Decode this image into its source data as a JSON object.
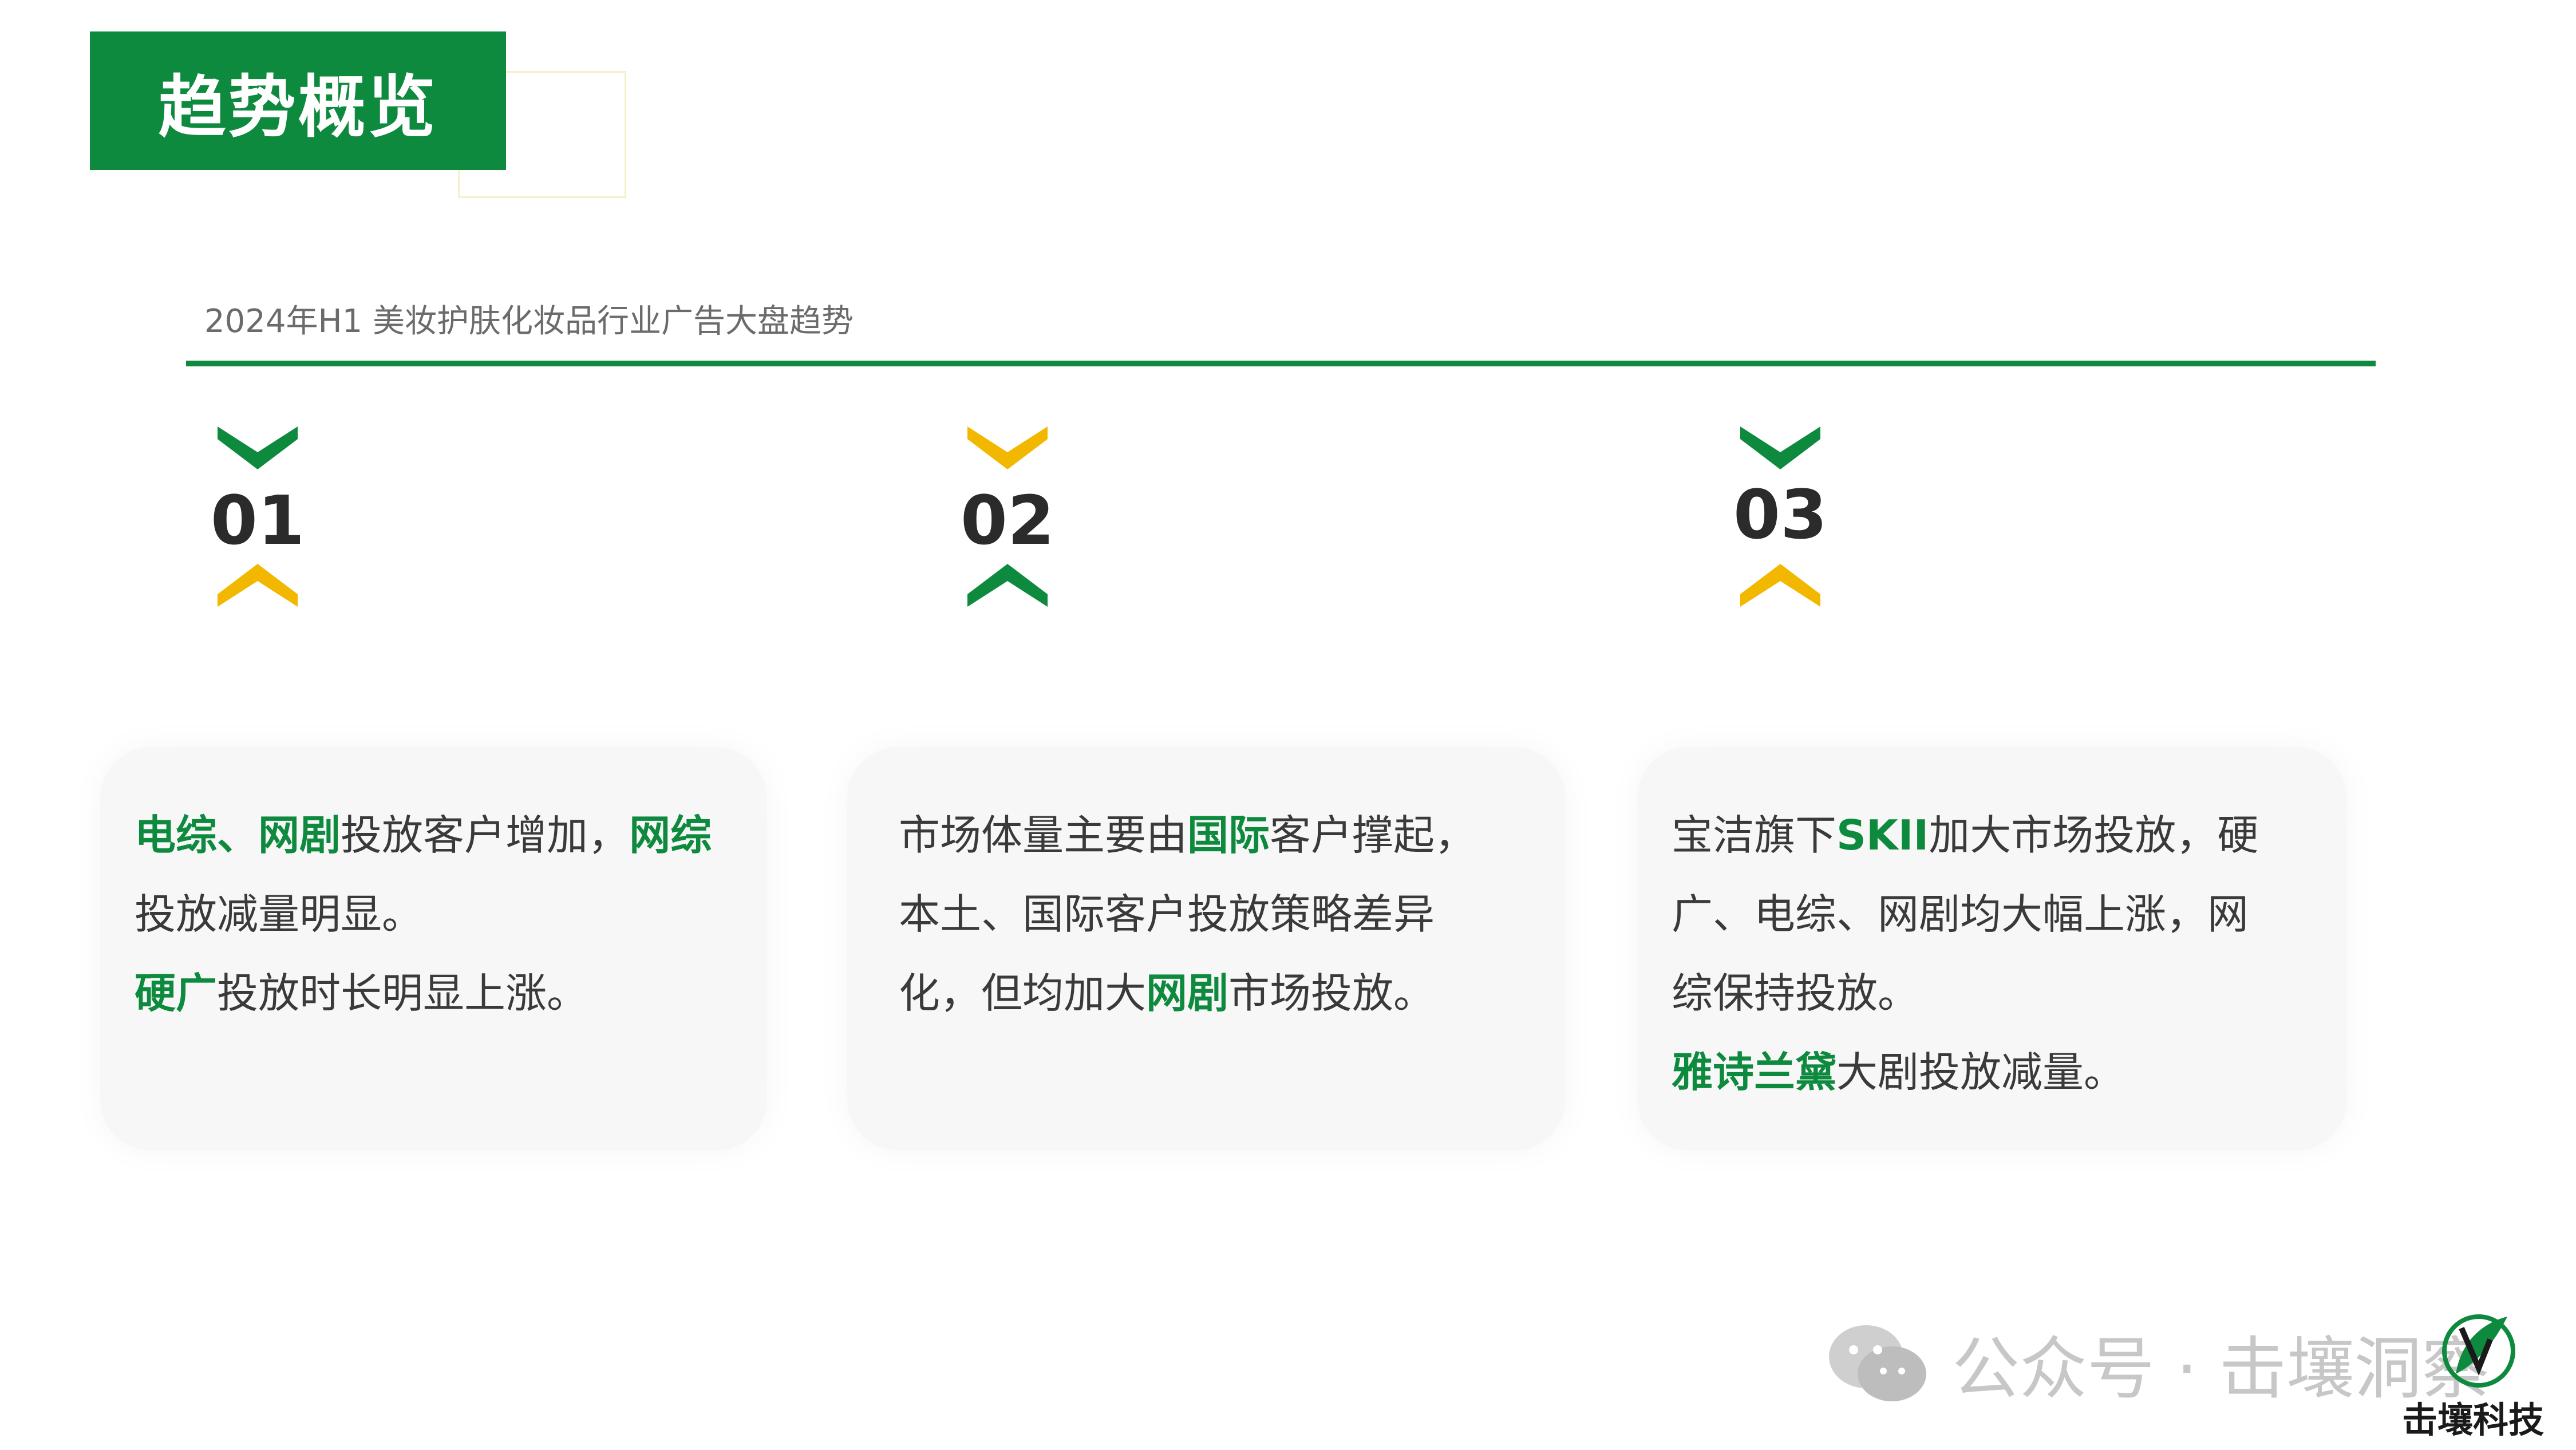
{
  "header": {
    "title": "趋势概览",
    "subtitle": "2024年H1 美妆护肤化妆品行业广告大盘趋势"
  },
  "colors": {
    "brand_green": "#0e8a3e",
    "accent_yellow": "#f2b800",
    "card_bg": "#f7f7f7"
  },
  "steps": [
    {
      "number": "01",
      "top_chevron_color": "green",
      "bottom_chevron_color": "yellow"
    },
    {
      "number": "02",
      "top_chevron_color": "yellow",
      "bottom_chevron_color": "green"
    },
    {
      "number": "03",
      "top_chevron_color": "green",
      "bottom_chevron_color": "yellow"
    }
  ],
  "cards": [
    {
      "lines": [
        [
          {
            "t": "电综",
            "hl": true
          },
          {
            "t": "、",
            "hl": true
          },
          {
            "t": "网剧",
            "hl": true
          },
          {
            "t": "投放客户增加，",
            "hl": false
          },
          {
            "t": "网综",
            "hl": true
          }
        ],
        [
          {
            "t": "投放减量明显。",
            "hl": false
          }
        ],
        [
          {
            "t": "硬广",
            "hl": true
          },
          {
            "t": "投放时长明显上涨。",
            "hl": false
          }
        ]
      ]
    },
    {
      "lines": [
        [
          {
            "t": "市场体量主要由",
            "hl": false
          },
          {
            "t": "国际",
            "hl": true
          },
          {
            "t": "客户撑起，",
            "hl": false
          }
        ],
        [
          {
            "t": "本土、国际客户投放策略差异",
            "hl": false
          }
        ],
        [
          {
            "t": "化，但均加大",
            "hl": false
          },
          {
            "t": "网剧",
            "hl": true
          },
          {
            "t": "市场投放。",
            "hl": false
          }
        ]
      ]
    },
    {
      "lines": [
        [
          {
            "t": "宝洁旗下",
            "hl": false
          },
          {
            "t": "SKII",
            "hl": true
          },
          {
            "t": "加大市场投放，硬",
            "hl": false
          }
        ],
        [
          {
            "t": "广、电综、网剧均大幅上涨，网",
            "hl": false
          }
        ],
        [
          {
            "t": "综保持投放。",
            "hl": false
          }
        ],
        [
          {
            "t": "雅诗兰黛",
            "hl": true
          },
          {
            "t": "大剧投放减量。",
            "hl": false
          }
        ]
      ]
    }
  ],
  "watermark": {
    "icon": "wechat-icon",
    "text": "公众号 · 击壤洞察"
  },
  "logo": {
    "text": "击壤科技"
  }
}
